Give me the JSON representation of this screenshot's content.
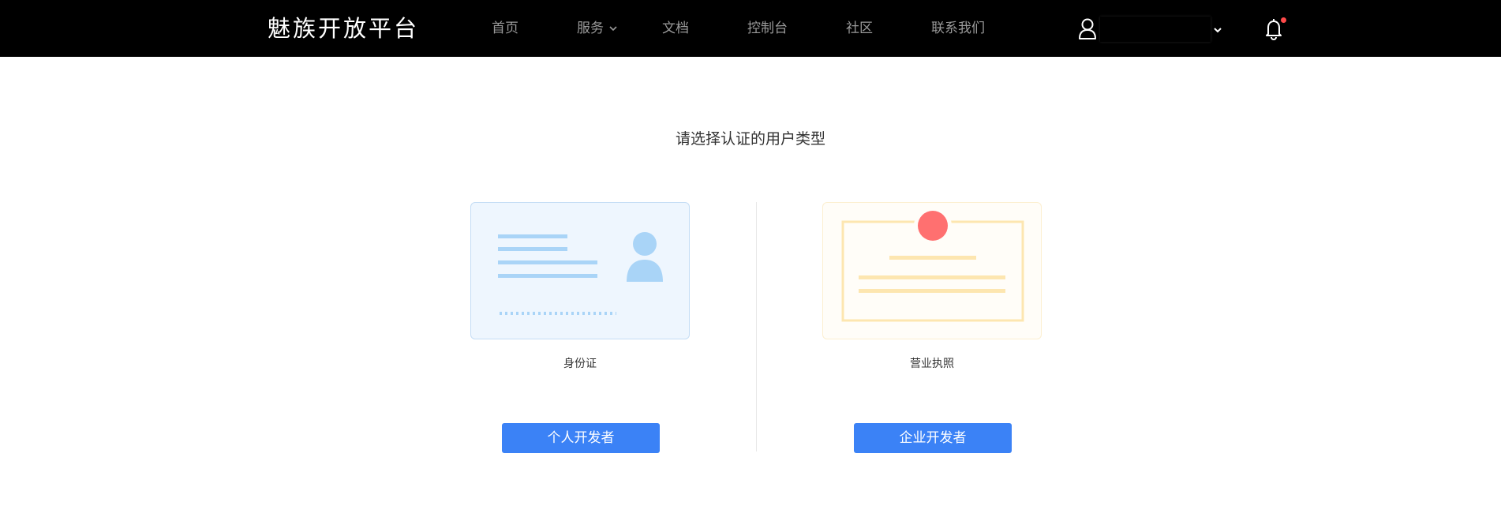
{
  "header": {
    "logo": "魅族开放平台",
    "nav": [
      {
        "label": "首页"
      },
      {
        "label": "服务"
      },
      {
        "label": "文档"
      },
      {
        "label": "控制台"
      },
      {
        "label": "社区"
      },
      {
        "label": "联系我们"
      }
    ],
    "user_name": "",
    "notification_has_unread": true
  },
  "main": {
    "title": "请选择认证的用户类型",
    "options": [
      {
        "card_label": "身份证",
        "button_label": "个人开发者"
      },
      {
        "card_label": "营业执照",
        "button_label": "企业开发者"
      }
    ]
  },
  "icons": {
    "service_menu": "chevron-down-icon",
    "user": "user-icon",
    "user_menu": "chevron-down-icon",
    "notifications": "bell-icon",
    "id_card": "id-card-icon",
    "business_license": "certificate-icon"
  },
  "colors": {
    "header_bg": "#000000",
    "nav_text": "#9a9a9a",
    "primary_button": "#3b82f6",
    "notification_dot": "#ff4a4a",
    "id_card_accent": "#a9d4f7",
    "license_accent": "#fde6b0",
    "license_seal": "#ff7070"
  }
}
